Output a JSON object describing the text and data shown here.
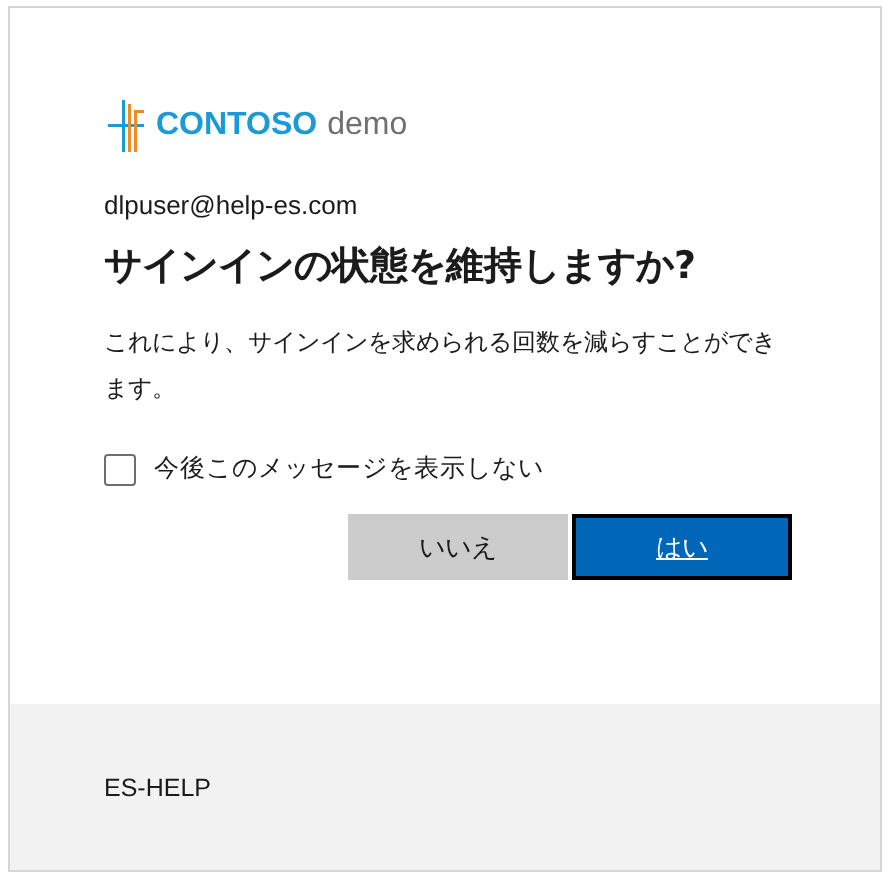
{
  "logo": {
    "brand": "CONTOSO",
    "suffix": "demo"
  },
  "account": "dlpuser@help-es.com",
  "title": "サインインの状態を維持しますか?",
  "description": "これにより、サインインを求められる回数を減らすことができます。",
  "checkbox": {
    "label": "今後このメッセージを表示しない",
    "checked": false
  },
  "buttons": [
    {
      "label": "いいえ",
      "kind": "secondary"
    },
    {
      "label": "はい",
      "kind": "primary"
    }
  ],
  "footer": "ES-HELP"
}
